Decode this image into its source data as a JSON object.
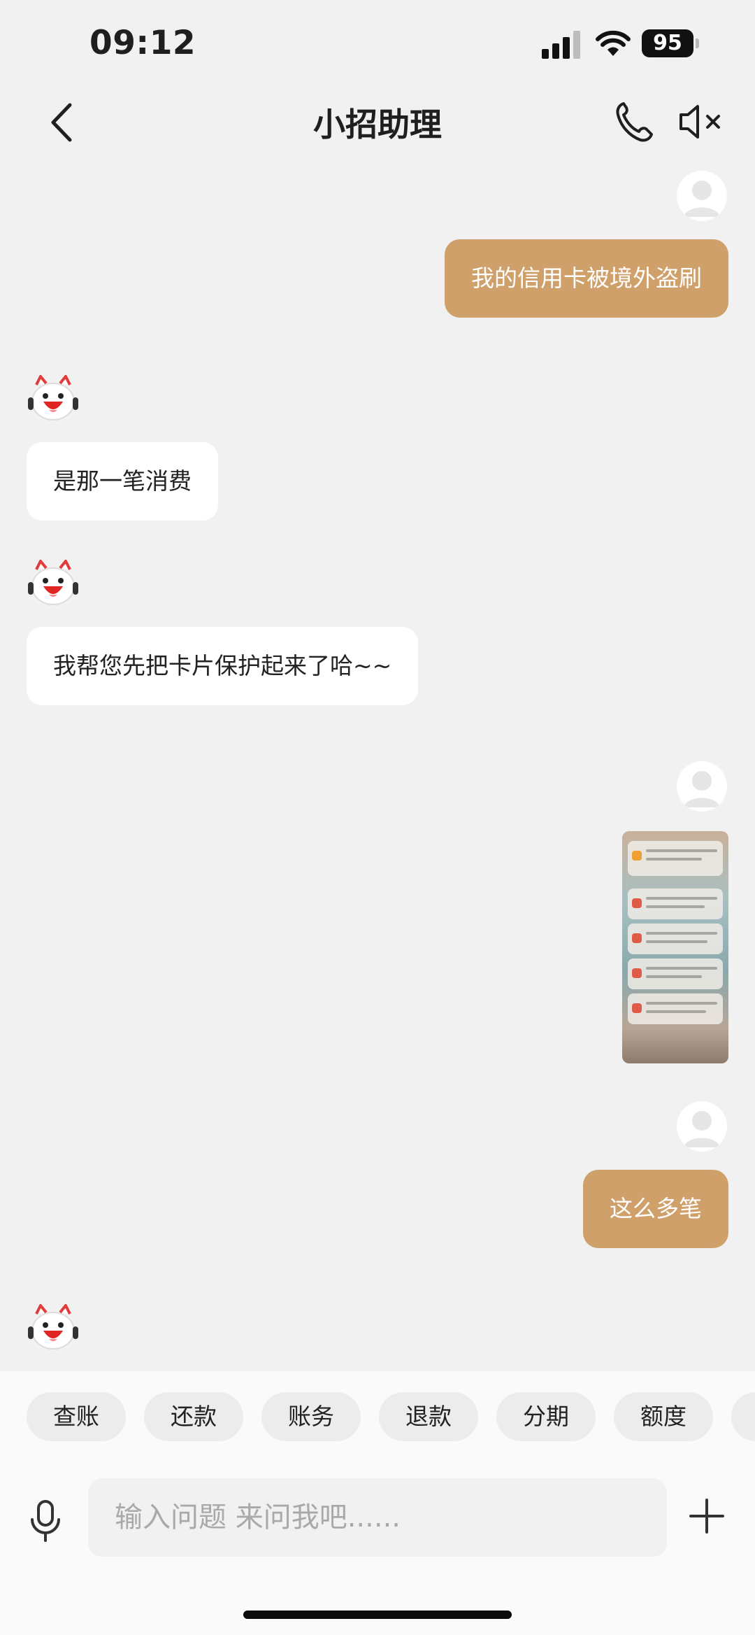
{
  "status_bar": {
    "time": "09:12",
    "battery": "95"
  },
  "nav": {
    "title": "小招助理"
  },
  "messages": [
    {
      "from": "user",
      "text": "我的信用卡被境外盗刷"
    },
    {
      "from": "bot",
      "text": "是那一笔消费"
    },
    {
      "from": "bot",
      "text": "我帮您先把卡片保护起来了哈~~"
    },
    {
      "from": "user",
      "type": "image",
      "alt": "screenshot of transaction notifications"
    },
    {
      "from": "user",
      "text": "这么多笔"
    },
    {
      "from": "bot",
      "text": ""
    }
  ],
  "quick_chips": [
    "查账",
    "还款",
    "账务",
    "退款",
    "分期",
    "额度"
  ],
  "input": {
    "placeholder": "输入问题 来问我吧......"
  },
  "colors": {
    "user_bubble": "#d0a06a",
    "bot_bubble": "#ffffff",
    "background": "#f1f1f1"
  }
}
